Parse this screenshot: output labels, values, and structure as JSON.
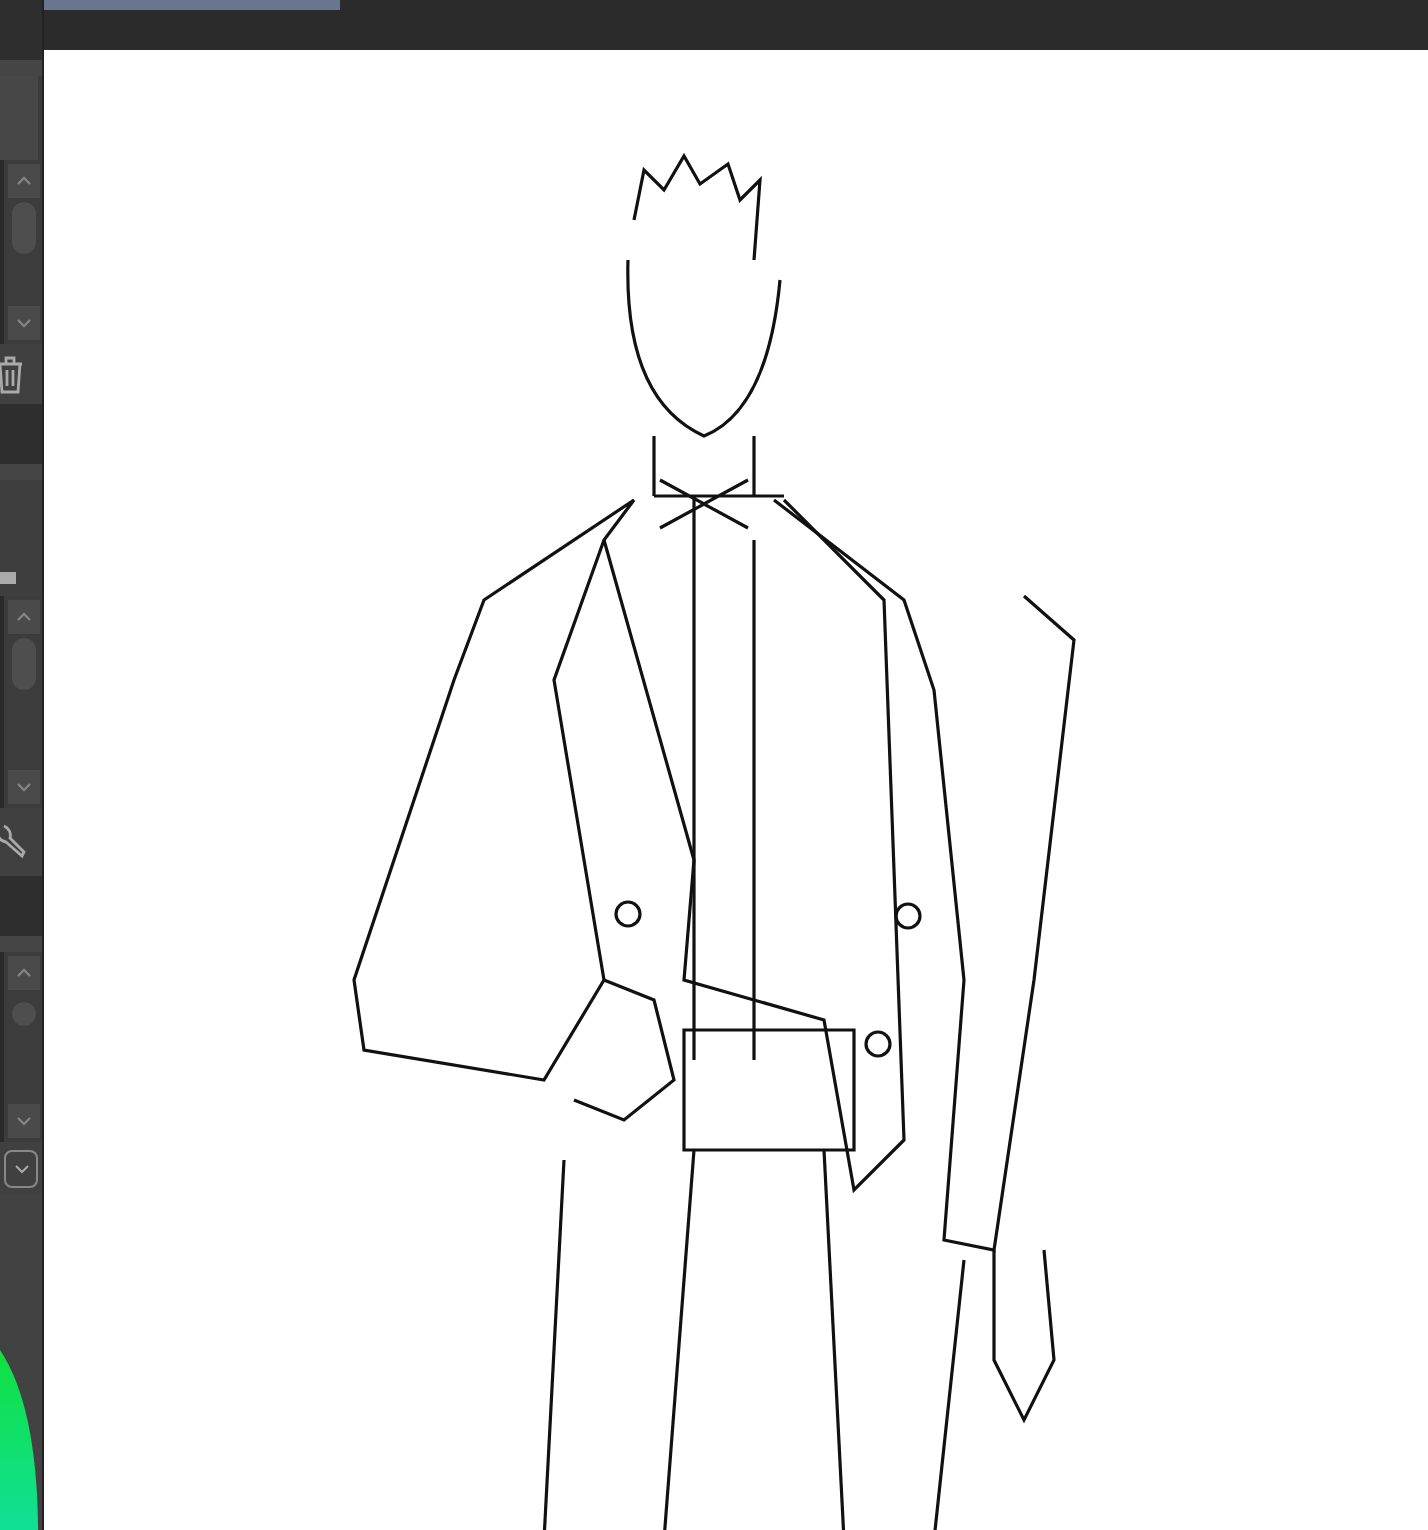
{
  "document_tabs": [
    {
      "selected": true
    }
  ],
  "panels": [
    {
      "kind": "list"
    },
    {
      "kind": "list"
    },
    {
      "kind": "list"
    },
    {
      "kind": "color"
    }
  ]
}
